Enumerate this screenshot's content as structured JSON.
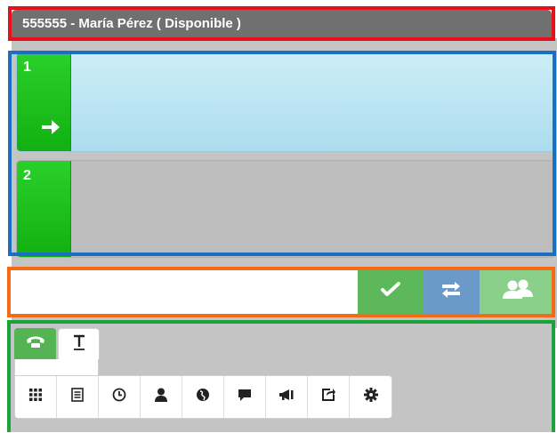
{
  "agent": {
    "status_label": "555555 - María Pérez ( Disponible )"
  },
  "lines": [
    {
      "number": "1",
      "state": "active"
    },
    {
      "number": "2",
      "state": "idle"
    }
  ],
  "dial": {
    "value": "",
    "placeholder": ""
  },
  "actions": {
    "confirm_icon": "check-icon",
    "transfer_icon": "transfer-arrows-icon",
    "conference_icon": "users-group-icon"
  },
  "tabs": [
    {
      "icon": "phone-icon",
      "selected": true
    },
    {
      "icon": "text-icon",
      "selected": false
    }
  ],
  "tools": [
    "keypad-grid-icon",
    "list-icon",
    "clock-icon",
    "user-icon",
    "globe-icon",
    "chat-icon",
    "megaphone-icon",
    "share-icon",
    "gear-icon"
  ],
  "colors": {
    "active_line": "#b8e4f2",
    "line_tab": "#1ec21e",
    "confirm": "#5db85c",
    "transfer": "#6b9ac8",
    "conference": "#8ad08a",
    "header": "#707070"
  }
}
